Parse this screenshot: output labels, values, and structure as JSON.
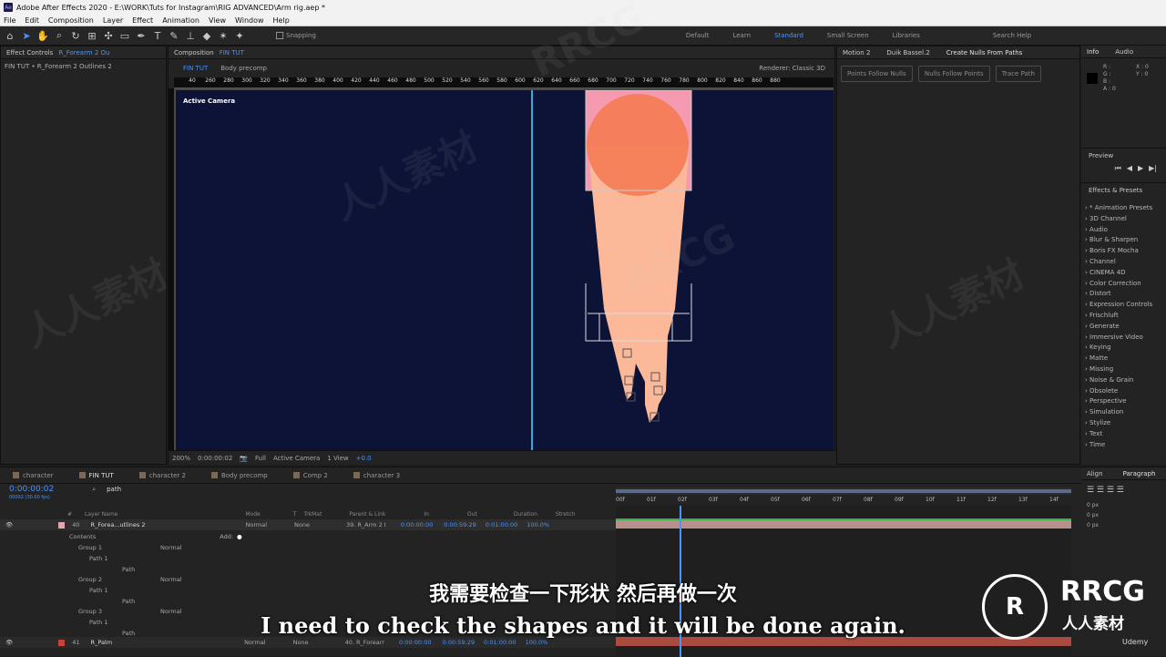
{
  "titlebar": {
    "logo": "Ae",
    "title": "Adobe After Effects 2020 - E:\\WORK\\Tuts for Instagram\\RIG ADVANCED\\Arm rig.aep *"
  },
  "menu": [
    "File",
    "Edit",
    "Composition",
    "Layer",
    "Effect",
    "Animation",
    "View",
    "Window",
    "Help"
  ],
  "toolbar": {
    "snapping": "Snapping",
    "workspaces": [
      "Default",
      "Learn",
      "Standard",
      "Small Screen",
      "Libraries"
    ],
    "active_workspace": "Standard",
    "search": "Search Help"
  },
  "effect_controls": {
    "tab": "Effect Controls",
    "layer": "R_Forearm 2 Ou",
    "breadcrumb": "FIN TUT • R_Forearm 2 Outlines 2"
  },
  "composition": {
    "tab": "Composition",
    "name": "FIN TUT",
    "subtabs": [
      "FIN TUT",
      "Body precomp"
    ],
    "renderer_label": "Renderer:",
    "renderer": "Classic 3D",
    "camera_label": "Active Camera",
    "ruler": [
      "40",
      "260",
      "280",
      "300",
      "320",
      "340",
      "360",
      "380",
      "400",
      "420",
      "440",
      "460",
      "480",
      "500",
      "520",
      "540",
      "560",
      "580",
      "600",
      "620",
      "640",
      "660",
      "680",
      "700",
      "720",
      "740",
      "760",
      "780",
      "800",
      "820",
      "840",
      "860",
      "880"
    ]
  },
  "comp_footer": {
    "zoom": "200%",
    "timecode": "0:00:00:02",
    "resolution": "Full",
    "camera": "Active Camera",
    "view": "1 View",
    "offset": "+0.0"
  },
  "nulls_panel": {
    "tabs": [
      "Motion 2",
      "Duik Bassel.2",
      "Create Nulls From Paths"
    ],
    "buttons": [
      "Points Follow Nulls",
      "Nulls Follow Points",
      "Trace Path"
    ]
  },
  "info": {
    "tabs": [
      "Info",
      "Audio"
    ],
    "values": [
      "R :",
      "G :",
      "B :",
      "A : 0"
    ],
    "coords": [
      "X : 0",
      "Y : 0"
    ]
  },
  "preview": {
    "title": "Preview"
  },
  "effects_presets": {
    "title": "Effects & Presets",
    "items": [
      "* Animation Presets",
      "3D Channel",
      "Audio",
      "Blur & Sharpen",
      "Boris FX Mocha",
      "Channel",
      "CINEMA 4D",
      "Color Correction",
      "Distort",
      "Expression Controls",
      "Frischluft",
      "Generate",
      "Immersive Video",
      "Keying",
      "Matte",
      "Missing",
      "Noise & Grain",
      "Obsolete",
      "Perspective",
      "Simulation",
      "Stylize",
      "Text",
      "Time"
    ]
  },
  "timeline": {
    "tabs": [
      {
        "label": "character",
        "color": "#7a6a55"
      },
      {
        "label": "FIN TUT",
        "color": "#7a6a55"
      },
      {
        "label": "character 2",
        "color": "#7a6a55"
      },
      {
        "label": "Body precomp",
        "color": "#7a6a55"
      },
      {
        "label": "Comp 2",
        "color": "#7a6a55"
      },
      {
        "label": "character 3",
        "color": "#7a6a55"
      }
    ],
    "timecode": "0:00:00:02",
    "fps": "00002 (30.00 fps)",
    "search": "path",
    "columns": [
      "#",
      "Layer Name",
      "Mode",
      "T",
      "TrkMat",
      "Parent & Link",
      "In",
      "Out",
      "Duration",
      "Stretch"
    ],
    "ruler": [
      "00f",
      "01f",
      "02f",
      "03f",
      "04f",
      "05f",
      "06f",
      "07f",
      "08f",
      "09f",
      "10f",
      "11f",
      "12f",
      "13f",
      "14f"
    ],
    "layer40": {
      "num": "40",
      "name": "R_Forea...utlines 2",
      "mode": "Normal",
      "trkmat": "None",
      "parent": "39. R_Arm 2 I",
      "in": "0:00:00:00",
      "out": "0:00:59:29",
      "duration": "0:01:00:00",
      "stretch": "100.0%"
    },
    "contents": "Contents",
    "add": "Add:",
    "groups": [
      {
        "group": "Group 1",
        "path": "Path 1",
        "prop": "Path",
        "mode": "Normal"
      },
      {
        "group": "Group 2",
        "path": "Path 1",
        "prop": "Path",
        "mode": "Normal"
      },
      {
        "group": "Group 3",
        "path": "Path 1",
        "prop": "Path",
        "mode": "Normal"
      }
    ],
    "layer41": {
      "num": "41",
      "name": "R_Palm",
      "mode": "Normal",
      "trkmat": "None",
      "parent": "40. R_Forearr",
      "in": "0:00:00:00",
      "out": "0:00:59:29",
      "duration": "0:01:00:00",
      "stretch": "100.0%"
    }
  },
  "align_panel": {
    "tabs": [
      "Align",
      "Paragraph"
    ],
    "values": [
      "0 px",
      "0 px",
      "0 px",
      "0 px",
      "0 px"
    ]
  },
  "subtitles": {
    "cn": "我需要检查一下形状 然后再做一次",
    "en": "I need to check the shapes and it will be done again."
  },
  "branding": {
    "logo": "RRCG",
    "sub": "人人素材",
    "udemy": "Udemy"
  },
  "colors": {
    "accent": "#4b93ff",
    "canvas": "#0d1336",
    "arm": "#fbb99a",
    "circle": "#f57c54",
    "pink": "#f59ab0"
  }
}
